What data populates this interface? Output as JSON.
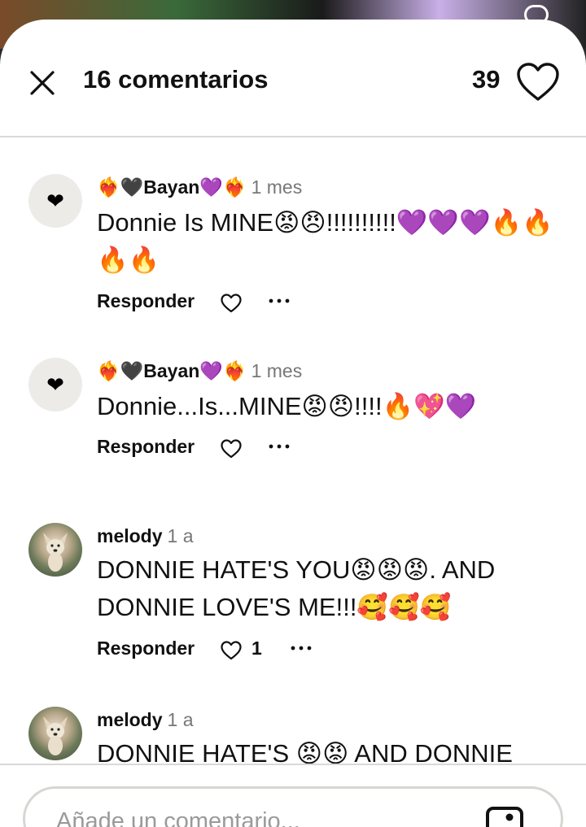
{
  "header": {
    "title": "16 comentarios",
    "likes": "39"
  },
  "comments": [
    {
      "user": "❤️‍🔥🖤Bayan💜❤️‍🔥",
      "time": "1 mes",
      "text": "Donnie Is MINE😡😠!!!!!!!!!!💜💜💜🔥🔥🔥🔥",
      "reply_label": "Responder",
      "like_count": "",
      "avatar": "❤"
    },
    {
      "user": "❤️‍🔥🖤Bayan💜❤️‍🔥",
      "time": "1 mes",
      "text": "Donnie...Is...MINE😡😠!!!!🔥💖💜",
      "reply_label": "Responder",
      "like_count": "",
      "avatar": "❤"
    },
    {
      "user": "melody",
      "time": "1 a",
      "text": "DONNIE HATE'S YOU😡😡😡. AND DONNIE LOVE'S ME!!!🥰🥰🥰",
      "reply_label": "Responder",
      "like_count": "1",
      "avatar": ""
    },
    {
      "user": "melody",
      "time": "1 a",
      "text": "DONNIE HATE'S 😡😡 AND DONNIE LOVE'S ME!🥰🥰🥰",
      "reply_label": "",
      "like_count": "",
      "avatar": ""
    }
  ],
  "footer": {
    "placeholder": "Añade un comentario..."
  },
  "colors": {
    "text": "#111111",
    "muted": "#777777",
    "divider": "#d9d9d6"
  }
}
